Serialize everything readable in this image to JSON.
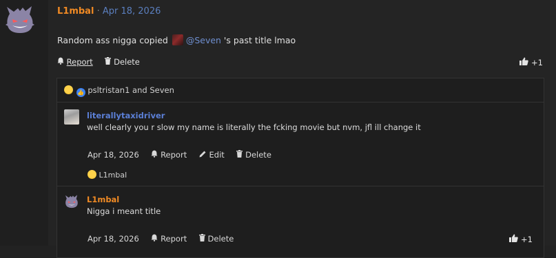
{
  "post": {
    "username": "L1mbal",
    "separator": "·",
    "date": "Apr 18, 2026",
    "body_prefix": "Random ass nigga copied",
    "mention": "@Seven",
    "body_suffix": " 's past title lmao",
    "actions": {
      "report": "Report",
      "delete": "Delete"
    },
    "like_count": "+1"
  },
  "reactions": {
    "text": "psltristan1 and Seven",
    "icons": [
      "laughing-emoji-icon",
      "like-reaction-icon"
    ]
  },
  "comments": [
    {
      "username": "literallytaxidriver",
      "text": "well clearly you r slow my name is literally the fcking movie but nvm, jfl ill change it",
      "date": "Apr 18, 2026",
      "actions": {
        "report": "Report",
        "edit": "Edit",
        "delete": "Delete"
      },
      "reaction_user": "L1mbal"
    },
    {
      "username": "L1mbal",
      "text": "Nigga i meant title",
      "date": "Apr 18, 2026",
      "actions": {
        "report": "Report",
        "delete": "Delete"
      },
      "like_count": "+1"
    }
  ],
  "colors": {
    "background": "#222222",
    "username_orange": "#f08a24",
    "username_blue": "#5b7fd6",
    "link_blue": "#5b7fbf"
  }
}
